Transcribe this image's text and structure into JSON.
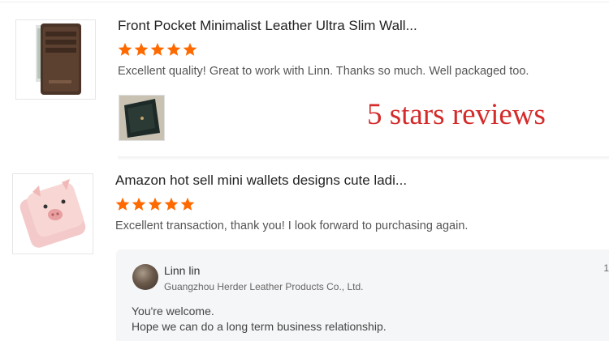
{
  "reviews": [
    {
      "product_title": "Front Pocket Minimalist Leather Ultra Slim Wall...",
      "rating": 5,
      "comment": "Excellent quality! Great to work with Linn. Thanks so much. Well packaged too."
    },
    {
      "product_title": "Amazon hot sell mini wallets designs cute ladi...",
      "rating": 5,
      "comment": "Excellent transaction, thank you! I look forward to purchasing again.",
      "reply": {
        "author": "Linn lin",
        "company": "Guangzhou Herder Leather Products Co., Ltd.",
        "lines": [
          "You're welcome.",
          "Hope we can do a long term business relationship."
        ],
        "corner_text": "1"
      }
    }
  ],
  "overlay_text": "5 stars reviews",
  "colors": {
    "star": "#ff6a00",
    "overlay": "#d42a2a",
    "reply_bg": "#f5f6f8"
  },
  "icons": [
    "star-icon"
  ]
}
